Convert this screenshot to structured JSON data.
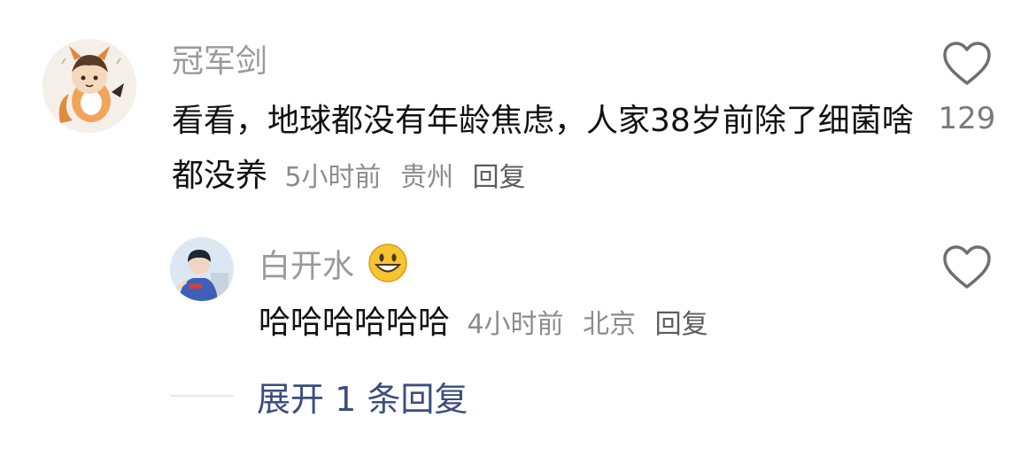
{
  "comment": {
    "username": "冠军剑",
    "text": "看看，地球都没有年龄焦虑，人家38岁前除了细菌啥都没养",
    "time": "5小时前",
    "location": "贵州",
    "reply_label": "回复",
    "likes": "129",
    "avatar_icon": "fox-character-avatar",
    "like_icon": "heart-outline-icon"
  },
  "reply": {
    "username": "白开水",
    "emoji": "😀",
    "text": "哈哈哈哈哈哈",
    "time": "4小时前",
    "location": "北京",
    "reply_label": "回复",
    "avatar_icon": "boy-character-avatar",
    "like_icon": "heart-outline-icon"
  },
  "expand": {
    "label": "展开 1 条回复"
  },
  "colors": {
    "username": "#9a9a9a",
    "content": "#111111",
    "meta": "#8c8c8c",
    "expand_link": "#3a4e7e"
  }
}
